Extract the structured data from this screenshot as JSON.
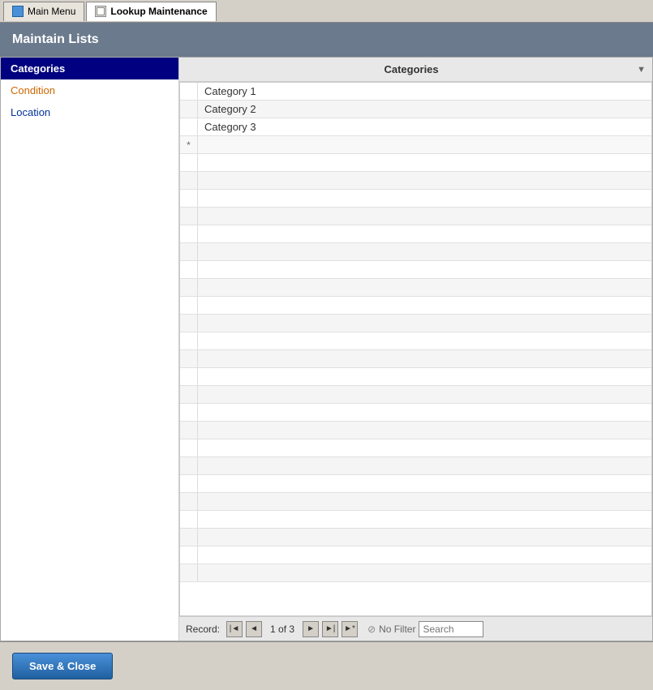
{
  "tabs": [
    {
      "id": "main-menu",
      "label": "Main Menu",
      "active": false
    },
    {
      "id": "lookup-maintenance",
      "label": "Lookup Maintenance",
      "active": true
    }
  ],
  "title_bar": {
    "title": "Maintain Lists"
  },
  "sidebar": {
    "items": [
      {
        "id": "categories",
        "label": "Categories",
        "selected": true,
        "style": "selected"
      },
      {
        "id": "condition",
        "label": "Condition",
        "style": "orange"
      },
      {
        "id": "location",
        "label": "Location",
        "style": "blue"
      }
    ]
  },
  "grid": {
    "column_header": "Categories",
    "rows": [
      {
        "id": 1,
        "value": "Category 1",
        "indicator": ""
      },
      {
        "id": 2,
        "value": "Category 2",
        "indicator": ""
      },
      {
        "id": 3,
        "value": "Category 3",
        "indicator": ""
      },
      {
        "id": 4,
        "value": "",
        "indicator": "*",
        "is_new": true
      }
    ]
  },
  "navigation": {
    "record_label": "Record:",
    "current_page": "1 of 3",
    "no_filter_label": "No Filter",
    "search_placeholder": "Search"
  },
  "footer": {
    "save_close_label": "Save & Close"
  }
}
